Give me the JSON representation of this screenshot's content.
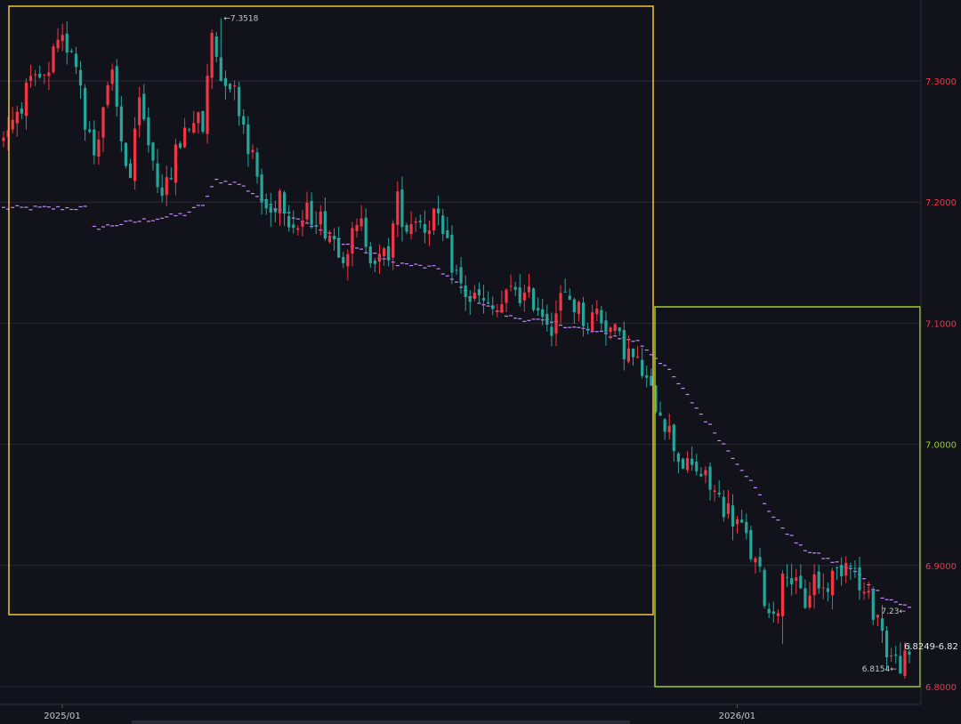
{
  "colors": {
    "background": "#12121a",
    "grid": "#2a2a35",
    "axis_text": "#c9c9c9",
    "up_candle": "#f23645",
    "down_candle": "#26a69a",
    "signal_marks": "#c58af9",
    "box_2025": "#f0c33c",
    "box_2026": "#9acd32",
    "axis_tick_2025": "#f23645",
    "axis_tick_2026": "#9acd32"
  },
  "annotations": {
    "high_label": "←7.3518",
    "low_label": "6.8154←",
    "mid_label": "7.23←",
    "last_label": "6.8249-6.82"
  },
  "chart_data": {
    "type": "candlestick",
    "title": "",
    "xlabel": "",
    "ylabel": "",
    "y_ticks": [
      "7.3000",
      "7.2000",
      "7.1000",
      "7.0000",
      "6.9000",
      "6.8000"
    ],
    "x_ticks": [
      "2025/01",
      "2026/01"
    ],
    "ylim": [
      6.79,
      7.36
    ],
    "highlight_2025": {
      "from": "2024-12",
      "to": "2025-12",
      "low": 6.86,
      "high": 7.36
    },
    "highlight_2026": {
      "from": "2025-12",
      "to": "2026-05",
      "low": 6.8,
      "high": 7.115
    },
    "anchors": [
      {
        "x": 0,
        "y": 7.25
      },
      {
        "x": 3,
        "y": 7.27
      },
      {
        "x": 6,
        "y": 7.29
      },
      {
        "x": 9,
        "y": 7.3
      },
      {
        "x": 11,
        "y": 7.3
      },
      {
        "x": 12,
        "y": 7.32
      },
      {
        "x": 14,
        "y": 7.33
      },
      {
        "x": 16,
        "y": 7.33
      },
      {
        "x": 18,
        "y": 7.3
      },
      {
        "x": 19,
        "y": 7.27
      },
      {
        "x": 21,
        "y": 7.24
      },
      {
        "x": 23,
        "y": 7.28
      },
      {
        "x": 25,
        "y": 7.3
      },
      {
        "x": 27,
        "y": 7.25
      },
      {
        "x": 29,
        "y": 7.22
      },
      {
        "x": 31,
        "y": 7.28
      },
      {
        "x": 33,
        "y": 7.25
      },
      {
        "x": 35,
        "y": 7.22
      },
      {
        "x": 37,
        "y": 7.21
      },
      {
        "x": 39,
        "y": 7.24
      },
      {
        "x": 41,
        "y": 7.26
      },
      {
        "x": 43,
        "y": 7.27
      },
      {
        "x": 45,
        "y": 7.26
      },
      {
        "x": 47,
        "y": 7.34
      },
      {
        "x": 49,
        "y": 7.31
      },
      {
        "x": 51,
        "y": 7.3
      },
      {
        "x": 53,
        "y": 7.28
      },
      {
        "x": 55,
        "y": 7.25
      },
      {
        "x": 57,
        "y": 7.22
      },
      {
        "x": 58,
        "y": 7.2
      },
      {
        "x": 60,
        "y": 7.19
      },
      {
        "x": 62,
        "y": 7.21
      },
      {
        "x": 64,
        "y": 7.19
      },
      {
        "x": 66,
        "y": 7.18
      },
      {
        "x": 68,
        "y": 7.19
      },
      {
        "x": 70,
        "y": 7.19
      },
      {
        "x": 72,
        "y": 7.18
      },
      {
        "x": 74,
        "y": 7.17
      },
      {
        "x": 76,
        "y": 7.16
      },
      {
        "x": 78,
        "y": 7.17
      },
      {
        "x": 80,
        "y": 7.18
      },
      {
        "x": 82,
        "y": 7.16
      },
      {
        "x": 84,
        "y": 7.15
      },
      {
        "x": 86,
        "y": 7.16
      },
      {
        "x": 88,
        "y": 7.2
      },
      {
        "x": 90,
        "y": 7.18
      },
      {
        "x": 92,
        "y": 7.19
      },
      {
        "x": 94,
        "y": 7.18
      },
      {
        "x": 96,
        "y": 7.19
      },
      {
        "x": 98,
        "y": 7.17
      },
      {
        "x": 100,
        "y": 7.15
      },
      {
        "x": 102,
        "y": 7.13
      },
      {
        "x": 104,
        "y": 7.12
      },
      {
        "x": 106,
        "y": 7.12
      },
      {
        "x": 108,
        "y": 7.11
      },
      {
        "x": 110,
        "y": 7.11
      },
      {
        "x": 112,
        "y": 7.12
      },
      {
        "x": 114,
        "y": 7.13
      },
      {
        "x": 116,
        "y": 7.12
      },
      {
        "x": 118,
        "y": 7.12
      },
      {
        "x": 120,
        "y": 7.11
      },
      {
        "x": 122,
        "y": 7.1
      },
      {
        "x": 124,
        "y": 7.12
      },
      {
        "x": 126,
        "y": 7.12
      },
      {
        "x": 128,
        "y": 7.11
      },
      {
        "x": 130,
        "y": 7.1
      },
      {
        "x": 132,
        "y": 7.11
      },
      {
        "x": 134,
        "y": 7.1
      },
      {
        "x": 136,
        "y": 7.09
      },
      {
        "x": 138,
        "y": 7.08
      },
      {
        "x": 140,
        "y": 7.07
      },
      {
        "x": 142,
        "y": 7.06
      },
      {
        "x": 144,
        "y": 7.04
      },
      {
        "x": 146,
        "y": 7.03
      },
      {
        "x": 148,
        "y": 7.01
      },
      {
        "x": 150,
        "y": 6.99
      },
      {
        "x": 152,
        "y": 6.98
      },
      {
        "x": 154,
        "y": 6.98
      },
      {
        "x": 156,
        "y": 6.97
      },
      {
        "x": 158,
        "y": 6.96
      },
      {
        "x": 160,
        "y": 6.95
      },
      {
        "x": 162,
        "y": 6.94
      },
      {
        "x": 164,
        "y": 6.93
      },
      {
        "x": 166,
        "y": 6.91
      },
      {
        "x": 168,
        "y": 6.89
      },
      {
        "x": 170,
        "y": 6.86
      },
      {
        "x": 172,
        "y": 6.87
      },
      {
        "x": 174,
        "y": 6.9
      },
      {
        "x": 176,
        "y": 6.88
      },
      {
        "x": 178,
        "y": 6.87
      },
      {
        "x": 180,
        "y": 6.89
      },
      {
        "x": 182,
        "y": 6.88
      },
      {
        "x": 184,
        "y": 6.89
      },
      {
        "x": 186,
        "y": 6.9
      },
      {
        "x": 188,
        "y": 6.91
      },
      {
        "x": 190,
        "y": 6.88
      },
      {
        "x": 192,
        "y": 6.87
      },
      {
        "x": 194,
        "y": 6.86
      },
      {
        "x": 196,
        "y": 6.83
      },
      {
        "x": 198,
        "y": 6.82
      },
      {
        "x": 200,
        "y": 6.82
      }
    ],
    "signal_anchors": [
      {
        "x": 0,
        "y": 7.195
      },
      {
        "x": 18,
        "y": 7.195
      },
      {
        "x": 19,
        "y": 7.178
      },
      {
        "x": 40,
        "y": 7.19
      },
      {
        "x": 44,
        "y": 7.198
      },
      {
        "x": 47,
        "y": 7.218
      },
      {
        "x": 52,
        "y": 7.215
      },
      {
        "x": 58,
        "y": 7.2
      },
      {
        "x": 66,
        "y": 7.185
      },
      {
        "x": 76,
        "y": 7.165
      },
      {
        "x": 86,
        "y": 7.15
      },
      {
        "x": 96,
        "y": 7.145
      },
      {
        "x": 104,
        "y": 7.12
      },
      {
        "x": 112,
        "y": 7.105
      },
      {
        "x": 122,
        "y": 7.1
      },
      {
        "x": 134,
        "y": 7.09
      },
      {
        "x": 140,
        "y": 7.085
      },
      {
        "x": 146,
        "y": 7.065
      },
      {
        "x": 152,
        "y": 7.035
      },
      {
        "x": 158,
        "y": 7.005
      },
      {
        "x": 164,
        "y": 6.975
      },
      {
        "x": 170,
        "y": 6.94
      },
      {
        "x": 176,
        "y": 6.915
      },
      {
        "x": 182,
        "y": 6.905
      },
      {
        "x": 188,
        "y": 6.895
      },
      {
        "x": 194,
        "y": 6.875
      },
      {
        "x": 200,
        "y": 6.865
      }
    ],
    "n_bars": 201,
    "x_tick_index": [
      11,
      160
    ],
    "high": {
      "x": 48,
      "y": 7.3518
    },
    "low": {
      "x": 198,
      "y": 6.8154
    }
  }
}
